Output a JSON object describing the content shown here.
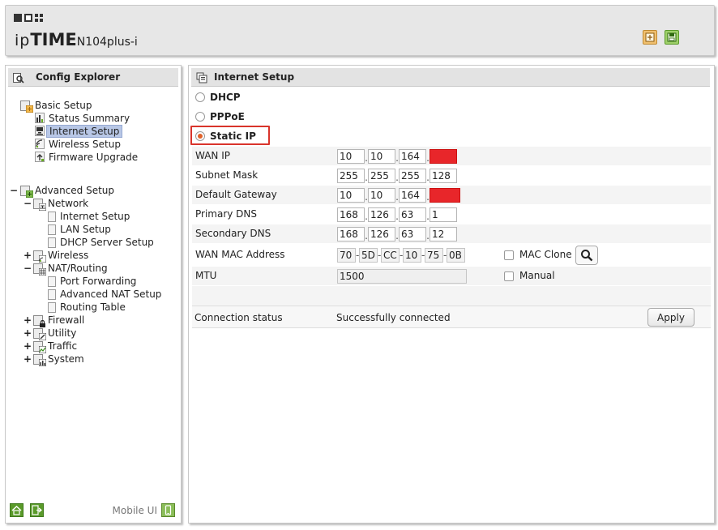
{
  "header": {
    "logo_ip": "ip",
    "logo_time": "TIME",
    "logo_model": "N104plus-i",
    "icons": [
      "window-solid-icon",
      "window-box-icon",
      "window-grid-icon",
      "new-window-icon",
      "save-icon"
    ]
  },
  "explorer": {
    "title": "Config Explorer",
    "basic_setup": {
      "label": "Basic Setup",
      "items": [
        "Status Summary",
        "Internet Setup",
        "Wireless Setup",
        "Firmware Upgrade"
      ],
      "selected": "Internet Setup"
    },
    "advanced_setup": {
      "label": "Advanced Setup",
      "network": {
        "label": "Network",
        "items": [
          "Internet Setup",
          "LAN Setup",
          "DHCP Server Setup"
        ]
      },
      "wireless": "Wireless",
      "nat": {
        "label": "NAT/Routing",
        "items": [
          "Port Forwarding",
          "Advanced NAT Setup",
          "Routing Table"
        ]
      },
      "firewall": "Firewall",
      "utility": "Utility",
      "traffic": "Traffic",
      "system": "System"
    },
    "footer": {
      "mobile_label": "Mobile UI"
    }
  },
  "internet_setup": {
    "title": "Internet Setup",
    "modes": [
      {
        "label": "DHCP",
        "checked": false
      },
      {
        "label": "PPPoE",
        "checked": false
      },
      {
        "label": "Static IP",
        "checked": true
      }
    ],
    "fields": {
      "wan_ip": {
        "label": "WAN IP",
        "octets": [
          "10",
          "10",
          "164",
          ""
        ]
      },
      "subnet_mask": {
        "label": "Subnet Mask",
        "octets": [
          "255",
          "255",
          "255",
          "128"
        ]
      },
      "default_gateway": {
        "label": "Default Gateway",
        "octets": [
          "10",
          "10",
          "164",
          ""
        ]
      },
      "primary_dns": {
        "label": "Primary DNS",
        "octets": [
          "168",
          "126",
          "63",
          "1"
        ]
      },
      "secondary_dns": {
        "label": "Secondary DNS",
        "octets": [
          "168",
          "126",
          "63",
          "12"
        ]
      },
      "wan_mac": {
        "label": "WAN MAC Address",
        "parts": [
          "70",
          "5D",
          "CC",
          "10",
          "75",
          "0B"
        ]
      },
      "mtu": {
        "label": "MTU",
        "value": "1500"
      }
    },
    "mac_clone": {
      "label": "MAC Clone",
      "checked": false
    },
    "manual": {
      "label": "Manual",
      "checked": false
    },
    "connection": {
      "label": "Connection status",
      "value": "Successfully connected"
    },
    "apply_label": "Apply"
  },
  "colors": {
    "selected_bg": "#b8c7e6",
    "redacted": "#e8262a",
    "highlight_border": "#d9342b",
    "radio_checked": "#e0622a"
  }
}
